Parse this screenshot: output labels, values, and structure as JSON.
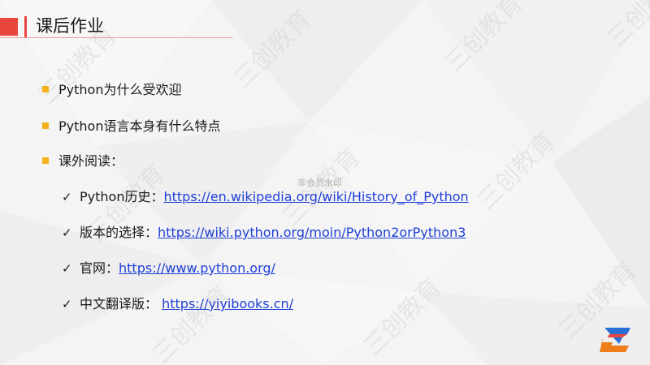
{
  "slide": {
    "title": "课后作业",
    "watermark_text": "三创教育",
    "nonmember_text": "非会员水印",
    "bullets": [
      "Python为什么受欢迎",
      "Python语言本身有什么特点",
      "课外阅读："
    ],
    "reading": [
      {
        "label": "Python历史：",
        "link": "https://en.wikipedia.org/wiki/History_of_Python"
      },
      {
        "label": "版本的选择：",
        "link": "https://wiki.python.org/moin/Python2orPython3"
      },
      {
        "label": "官网：",
        "link": "https://www.python.org/"
      },
      {
        "label": "中文翻译版：",
        "link": "https://yiyibooks.cn/"
      }
    ],
    "check_mark": "✓"
  },
  "colors": {
    "accent_red": "#e8453c",
    "bullet_yellow": "#f3b21b",
    "link_blue": "#1f3fd6",
    "logo_blue": "#2a6fd6",
    "logo_orange": "#ef7d1a"
  }
}
